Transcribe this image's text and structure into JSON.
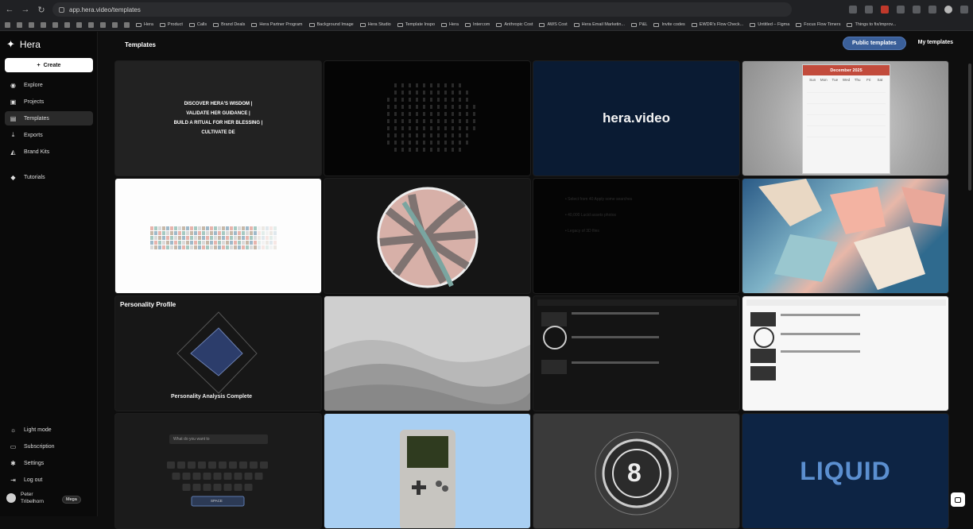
{
  "browser": {
    "url": "app.hera.video/templates",
    "bookmarks": [
      "Hera",
      "Product",
      "Calls",
      "Brand Deals",
      "Hera Partner Program",
      "Background Image",
      "Hera Studio",
      "Template Inspo",
      "Hera",
      "Intercom",
      "Anthropic Cost",
      "AWS Cost",
      "Hera Email Marketin...",
      "P&L",
      "Invite codes",
      "EWDR's Flow Check...",
      "Untitled – Figma",
      "Focus Flow Timers",
      "Things to fix/improv..."
    ]
  },
  "sidebar": {
    "brand": "Hera",
    "create_label": "Create",
    "items": [
      {
        "label": "Explore",
        "icon": "compass-icon"
      },
      {
        "label": "Projects",
        "icon": "folder-icon"
      },
      {
        "label": "Templates",
        "icon": "template-icon",
        "active": true
      },
      {
        "label": "Exports",
        "icon": "download-icon"
      },
      {
        "label": "Brand Kits",
        "icon": "brush-icon"
      },
      {
        "label": "Tutorials",
        "icon": "graduation-icon"
      }
    ],
    "bottom_items": [
      {
        "label": "Light mode",
        "icon": "sun-icon"
      },
      {
        "label": "Subscription",
        "icon": "card-icon"
      },
      {
        "label": "Settings",
        "icon": "gear-icon"
      },
      {
        "label": "Log out",
        "icon": "logout-icon"
      }
    ],
    "user": {
      "name": "Peter Tribelhorn",
      "plan": "Mega"
    }
  },
  "main": {
    "title": "Templates",
    "toggle": {
      "public": "Public templates",
      "mine": "My templates"
    },
    "cards": {
      "c1_lines": [
        "DISCOVER HERA'S WISDOM |",
        "VALIDATE HER GUIDANCE |",
        "BUILD A RITUAL FOR HER BLESSING |",
        "CULTIVATE DE"
      ],
      "c3_text": "hera.video",
      "c4_month": "December 2025",
      "c4_days": [
        "Sun",
        "Mon",
        "Tue",
        "Wed",
        "Thu",
        "Fri",
        "Sat"
      ],
      "c7_lines": [
        "• Select from 40 Apply some searches",
        "• 40,000 Lucid assets photos",
        "• Legacy of 3D files"
      ],
      "c9_title": "Personality Profile",
      "c9_subtitle": "Personality Analysis Complete",
      "c13_placeholder": "What do you want to",
      "c13_space": "SPACE",
      "c15_number": "8",
      "c16_text": "LIQUID"
    }
  }
}
